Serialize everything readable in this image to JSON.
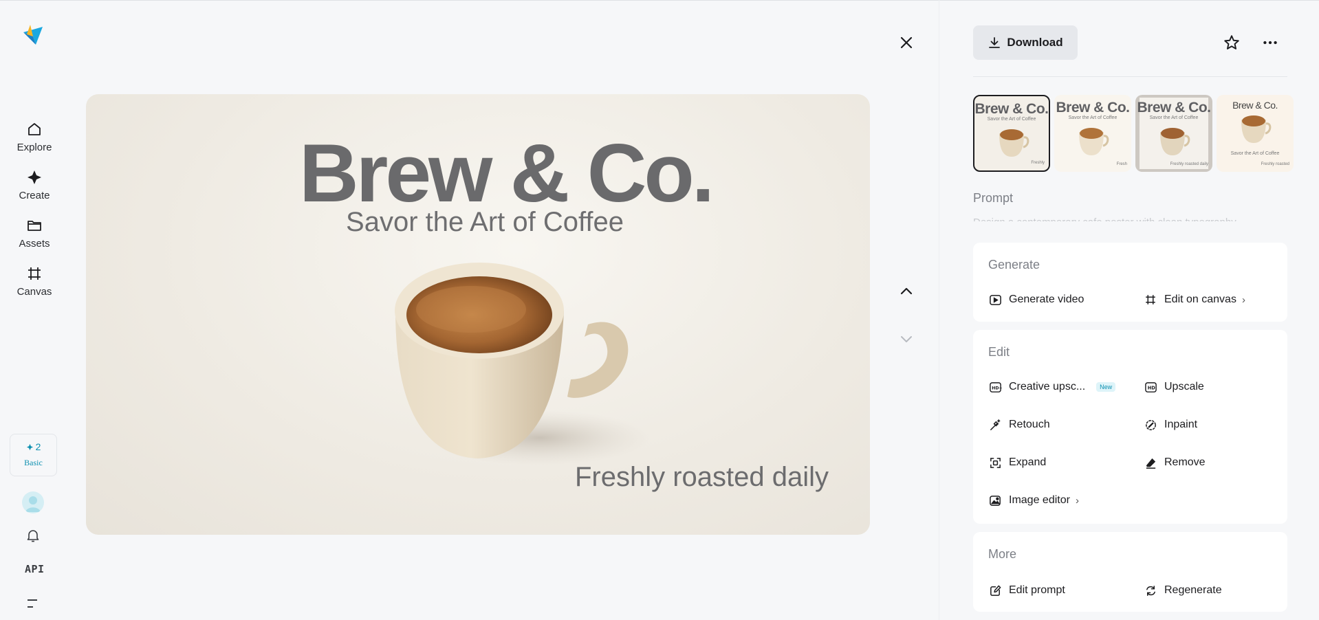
{
  "nav": {
    "items": [
      {
        "label": "Explore"
      },
      {
        "label": "Create"
      },
      {
        "label": "Assets"
      },
      {
        "label": "Canvas"
      }
    ],
    "credits": "2",
    "plan": "Basic",
    "api_label": "API"
  },
  "image": {
    "title": "Brew & Co.",
    "subtitle": "Savor the Art of Coffee",
    "tagline": "Freshly roasted daily"
  },
  "toolbar": {
    "download_label": "Download"
  },
  "thumbnails": [
    {
      "title": "Brew & Co.",
      "subtitle": "Savor the Art of Coffee",
      "footer": "Freshly",
      "selected": true
    },
    {
      "title": "Brew & Co.",
      "subtitle": "Savor the Art of Coffee",
      "footer": "Fresh",
      "selected": false
    },
    {
      "title": "Brew & Co.",
      "subtitle": "Savor the Art of Coffee",
      "footer": "Freshly roasted daily",
      "selected": false
    },
    {
      "title": "Brew & Co.",
      "subtitle": "Savor the Art of Coffee",
      "footer": "Freshly roasted",
      "selected": false
    }
  ],
  "prompt": {
    "label": "Prompt",
    "text": "Design a contemporary cafe poster with clean typography"
  },
  "generate": {
    "title": "Generate",
    "generate_video": "Generate video",
    "edit_on_canvas": "Edit on canvas"
  },
  "edit": {
    "title": "Edit",
    "creative_upscale": "Creative upsc...",
    "new_badge": "New",
    "upscale": "Upscale",
    "retouch": "Retouch",
    "inpaint": "Inpaint",
    "expand": "Expand",
    "remove": "Remove",
    "image_editor": "Image editor"
  },
  "more": {
    "title": "More",
    "edit_prompt": "Edit prompt",
    "regenerate": "Regenerate"
  },
  "colors": {
    "background": "#f6f7f9",
    "accent": "#0c8fb0",
    "card": "#ffffff"
  }
}
